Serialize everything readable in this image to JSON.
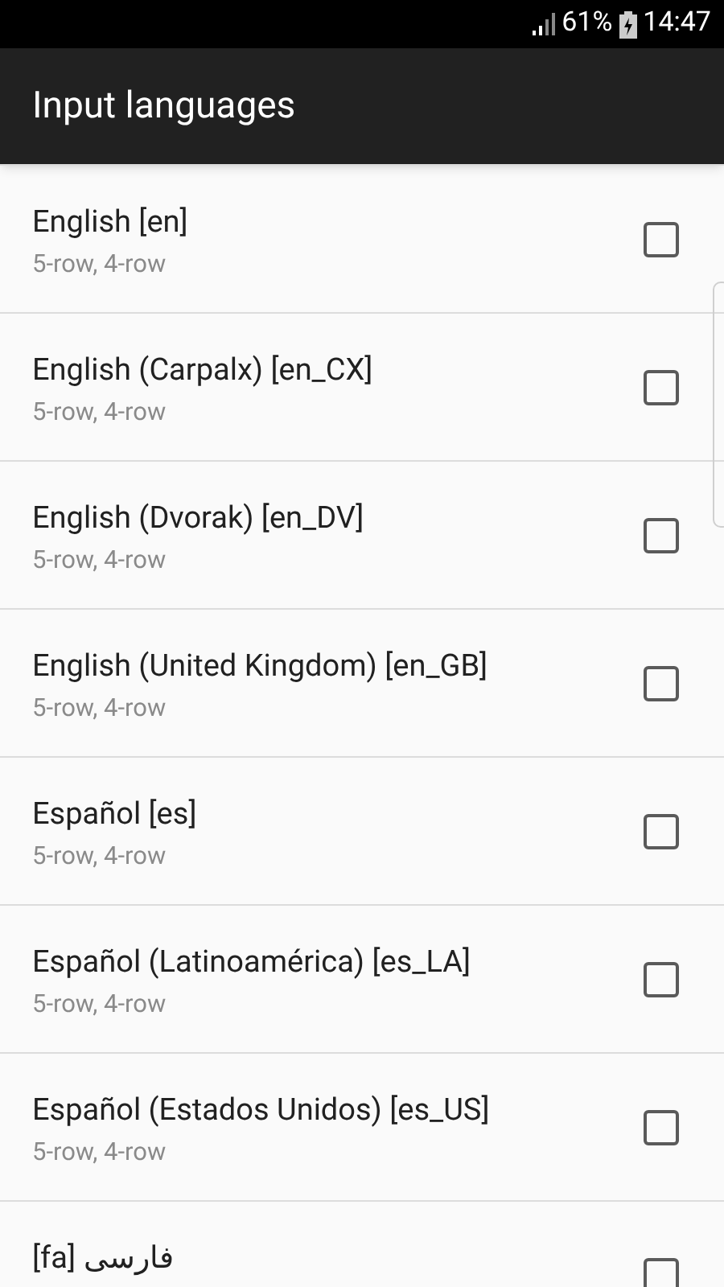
{
  "status_bar": {
    "battery": "61%",
    "time": "14:47"
  },
  "app_bar": {
    "title": "Input languages"
  },
  "languages": [
    {
      "name": "English [en]",
      "layouts": "5-row, 4-row",
      "checked": false
    },
    {
      "name": "English (Carpalx) [en_CX]",
      "layouts": "5-row, 4-row",
      "checked": false
    },
    {
      "name": "English (Dvorak) [en_DV]",
      "layouts": "5-row, 4-row",
      "checked": false
    },
    {
      "name": "English (United Kingdom) [en_GB]",
      "layouts": "5-row, 4-row",
      "checked": false
    },
    {
      "name": "Español [es]",
      "layouts": "5-row, 4-row",
      "checked": false
    },
    {
      "name": "Español (Latinoamérica) [es_LA]",
      "layouts": "5-row, 4-row",
      "checked": false
    },
    {
      "name": "Español (Estados Unidos) [es_US]",
      "layouts": "5-row, 4-row",
      "checked": false
    },
    {
      "name": "فارسی [fa]",
      "checked": false
    }
  ]
}
